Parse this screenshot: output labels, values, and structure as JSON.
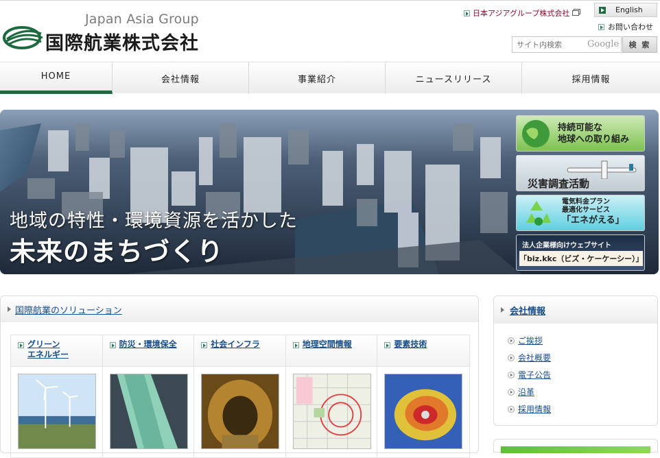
{
  "header": {
    "tagline": "Japan Asia Group",
    "company_name": "国際航業株式会社",
    "group_link": "日本アジアグループ株式会社",
    "english_label": "English",
    "inquiry_label": "お問い合わせ",
    "search_placeholder": "サイト内検索",
    "google_mark": "Google",
    "search_button": "検 索"
  },
  "nav": [
    {
      "label": "HOME",
      "active": true
    },
    {
      "label": "会社情報"
    },
    {
      "label": "事業紹介"
    },
    {
      "label": "ニュースリリース"
    },
    {
      "label": "採用情報"
    }
  ],
  "hero": {
    "line1": "地域の特性・環境資源を活かした",
    "line2": "未来のまちづくり",
    "banners": [
      {
        "line1": "持続可能な",
        "line2": "地球への取り組み"
      },
      {
        "line1": "災害調査活動"
      },
      {
        "line1": "電気料金プラン",
        "line2": "最適化サービス",
        "line3": "「エネがえる」"
      },
      {
        "line1": "法人企業様向けウェブサイト",
        "line2": "「biz.kkc（ビズ・ケーケーシー）」"
      }
    ]
  },
  "solutions": {
    "title": "国際航業のソリューション",
    "columns": [
      {
        "label": "グリーン\nエネルギー"
      },
      {
        "label": "防災・環境保全"
      },
      {
        "label": "社会インフラ"
      },
      {
        "label": "地理空間情報"
      },
      {
        "label": "要素技術"
      }
    ]
  },
  "sidebar": {
    "title": "会社情報",
    "items": [
      "ご挨拶",
      "会社概要",
      "電子公告",
      "沿革",
      "採用情報"
    ]
  },
  "colors": {
    "brand_green": "#1e6a3f",
    "link_blue": "#1a4f8a",
    "link_red": "#8b0a2a"
  }
}
